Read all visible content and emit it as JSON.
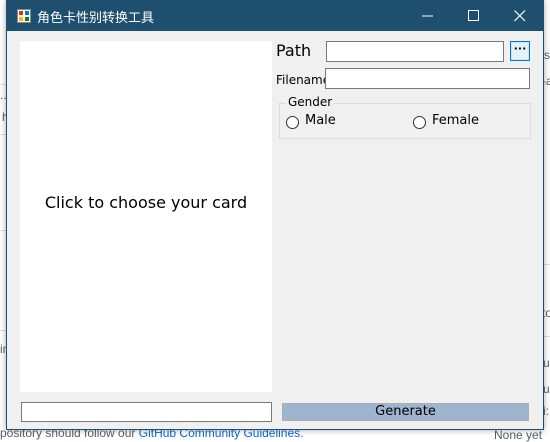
{
  "window": {
    "title": "角色卡性别转换工具",
    "accent_color": "#1e4f6f"
  },
  "card_area": {
    "prompt": "Click to choose your card"
  },
  "path": {
    "label": "Path",
    "value": "",
    "browse_label": "···"
  },
  "filename": {
    "label": "Filename",
    "value": ""
  },
  "gender": {
    "legend": "Gender",
    "options": [
      "Male",
      "Female"
    ],
    "selected": null
  },
  "status": {
    "value": ""
  },
  "generate": {
    "label": "Generate"
  },
  "background": {
    "fragments": [
      "s",
      "-a",
      "..",
      "h",
      "to",
      "ul",
      "ul",
      "in",
      "i:",
      "pository should follow our",
      "GitHub Community Guidelines.",
      "None yet"
    ]
  }
}
